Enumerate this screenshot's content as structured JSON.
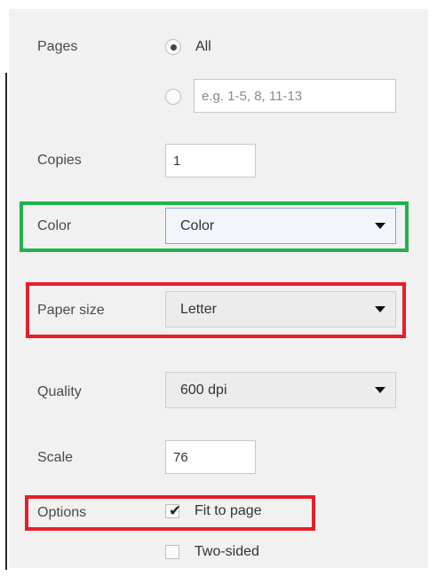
{
  "pages": {
    "label": "Pages",
    "option_all": "All",
    "custom_placeholder": "e.g. 1-5, 8, 11-13"
  },
  "copies": {
    "label": "Copies",
    "value": "1"
  },
  "color": {
    "label": "Color",
    "selected": "Color"
  },
  "paper_size": {
    "label": "Paper size",
    "selected": "Letter"
  },
  "quality": {
    "label": "Quality",
    "selected": "600 dpi"
  },
  "scale": {
    "label": "Scale",
    "value": "76"
  },
  "options": {
    "label": "Options",
    "fit_to_page": {
      "label": "Fit to page",
      "checked": true
    },
    "two_sided": {
      "label": "Two-sided",
      "checked": false
    }
  },
  "highlight_colors": {
    "green": "#22b14c",
    "red": "#e61e2b"
  }
}
